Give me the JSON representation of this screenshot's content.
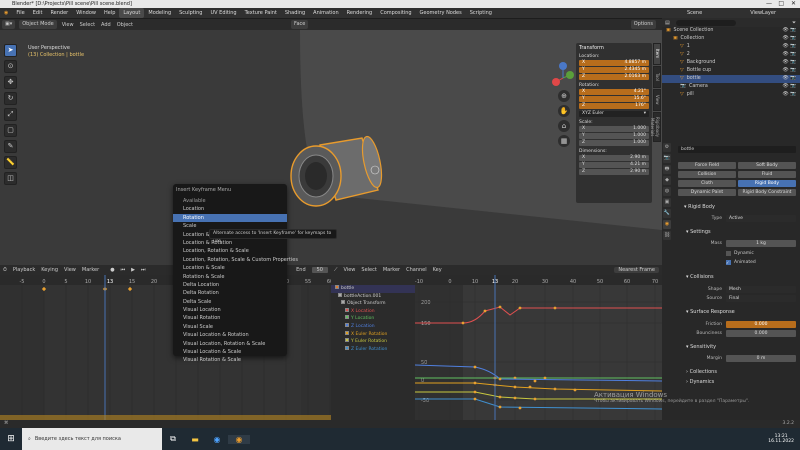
{
  "window": {
    "title": "Blender* [D:\\Projects\\Pill scene\\Pill scene.blend]",
    "controls": [
      "—",
      "□",
      "✕"
    ]
  },
  "menu": {
    "items": [
      "File",
      "Edit",
      "Render",
      "Window",
      "Help"
    ],
    "workspaces": [
      "Layout",
      "Modeling",
      "Sculpting",
      "UV Editing",
      "Texture Paint",
      "Shading",
      "Animation",
      "Rendering",
      "Compositing",
      "Geometry Nodes",
      "Scripting"
    ],
    "active_workspace": "Layout",
    "scene": "Scene",
    "view_layer": "ViewLayer"
  },
  "viewport": {
    "header": {
      "mode": "Object Mode",
      "items": [
        "View",
        "Select",
        "Add",
        "Object"
      ],
      "transform_orientation": "Face",
      "options": "Options"
    },
    "info_line1": "User Perspective",
    "info_line2": "(13) Collection | bottle",
    "nav_icons": [
      "axis-gizmo",
      "zoom-icon",
      "hand-pan-icon",
      "camera-icon",
      "grid-icon"
    ],
    "npanel": {
      "section": "Transform",
      "location_label": "Location:",
      "location": [
        {
          "axis": "X",
          "value": "4.8857 m"
        },
        {
          "axis": "Y",
          "value": "2.4345 m"
        },
        {
          "axis": "Z",
          "value": "2.0163 m"
        }
      ],
      "rotation_label": "Rotation:",
      "rotation": [
        {
          "axis": "X",
          "value": "4.21°"
        },
        {
          "axis": "Y",
          "value": "15.6°"
        },
        {
          "axis": "Z",
          "value": "176°"
        }
      ],
      "rotation_mode": "XYZ Euler",
      "scale_label": "Scale:",
      "scale": [
        {
          "axis": "X",
          "value": "1.000"
        },
        {
          "axis": "Y",
          "value": "1.000"
        },
        {
          "axis": "Z",
          "value": "1.000"
        }
      ],
      "dimensions_label": "Dimensions:",
      "dimensions": [
        {
          "axis": "X",
          "value": "2.90 m"
        },
        {
          "axis": "Y",
          "value": "4.21 m"
        },
        {
          "axis": "Z",
          "value": "2.90 m"
        }
      ]
    },
    "side_tabs": [
      "Item",
      "Tool",
      "View",
      "Rigidbody Materials"
    ]
  },
  "insert_keyframe_menu": {
    "title": "Insert Keyframe Menu",
    "items": [
      "Available",
      "Location",
      "Rotation",
      "Scale",
      "Location & ...",
      "Location & Rotation",
      "Location, Rotation & Scale",
      "Location, Rotation, Scale & Custom Properties",
      "Location & Scale",
      "Rotation & Scale",
      "Delta Location",
      "Delta Rotation",
      "Delta Scale",
      "Visual Location",
      "Visual Rotation",
      "Visual Scale",
      "Visual Location & Rotation",
      "Visual Location, Rotation & Scale",
      "Visual Location & Scale",
      "Visual Rotation & Scale"
    ],
    "highlighted": "Rotation",
    "tooltip": "Alternate access to 'Insert Keyframe' for keymaps to use."
  },
  "outliner": {
    "search_placeholder": "",
    "rows": [
      {
        "indent": 0,
        "name": "Scene Collection",
        "icon": "▣",
        "sel": false
      },
      {
        "indent": 1,
        "name": "Collection",
        "icon": "▣",
        "sel": false
      },
      {
        "indent": 2,
        "name": "1",
        "icon": "▽",
        "sel": false
      },
      {
        "indent": 2,
        "name": "2",
        "icon": "▽",
        "sel": false
      },
      {
        "indent": 2,
        "name": "Background",
        "icon": "▽",
        "sel": false
      },
      {
        "indent": 2,
        "name": "Bottle cup",
        "icon": "▽",
        "sel": false
      },
      {
        "indent": 2,
        "name": "bottle",
        "icon": "▽",
        "sel": true
      },
      {
        "indent": 2,
        "name": "Camera",
        "icon": "📷",
        "sel": false
      },
      {
        "indent": 2,
        "name": "pill",
        "icon": "▽",
        "sel": false
      }
    ]
  },
  "properties": {
    "object_name": "bottle",
    "buttons_row1": [
      "Force Field",
      "Soft Body"
    ],
    "buttons_row2": [
      "Collision",
      "Fluid"
    ],
    "buttons_row3": [
      "Cloth",
      "Rigid Body"
    ],
    "buttons_row4": [
      "Dynamic Paint",
      "Rigid Body Constraint"
    ],
    "rigid_body": "Rigid Body",
    "type_label": "Type",
    "type_value": "Active",
    "settings": "Settings",
    "mass_label": "Mass",
    "mass_value": "1 kg",
    "dynamic": "Dynamic",
    "animated": "Animated",
    "collisions": "Collisions",
    "shape_label": "Shape",
    "shape_value": "Mesh",
    "source_label": "Source",
    "source_value": "Final",
    "surface_response": "Surface Response",
    "friction_label": "Friction",
    "friction_value": "0.000",
    "bounciness_label": "Bounciness",
    "bounciness_value": "0.000",
    "sensitivity": "Sensitivity",
    "margin_label": "Margin",
    "margin_value": "0 m",
    "collections": "Collections",
    "dynamics": "Dynamics"
  },
  "timeline": {
    "menus": [
      "Playback",
      "Keying",
      "View",
      "Marker"
    ],
    "end_label": "End",
    "end_value": "50",
    "ruler": [
      "-5",
      "0",
      "5",
      "10",
      "13",
      "15",
      "20",
      "25",
      "30",
      "35",
      "40",
      "45",
      "50",
      "55",
      "60"
    ],
    "current_frame": "13"
  },
  "graph_editor": {
    "menus": [
      "View",
      "Select",
      "Marker",
      "Channel",
      "Key"
    ],
    "snap": "Nearest Frame",
    "ruler": [
      "-10",
      "0",
      "10",
      "13",
      "20",
      "30",
      "40",
      "50",
      "60",
      "70"
    ],
    "y_labels": [
      "200",
      "150",
      "50",
      "0",
      "-50"
    ],
    "channels": [
      {
        "name": "bottle",
        "color": "#dd7a2d"
      },
      {
        "name": "bottleAction.001",
        "color": "#aaa"
      },
      {
        "name": "Object Transform",
        "color": "#aaa"
      },
      {
        "name": "X Location",
        "color": "#e05050"
      },
      {
        "name": "Y Location",
        "color": "#60c060"
      },
      {
        "name": "Z Location",
        "color": "#5080e0"
      },
      {
        "name": "X Euler Rotation",
        "color": "#e0a020"
      },
      {
        "name": "Y Euler Rotation",
        "color": "#c8c840"
      },
      {
        "name": "Z Euler Rotation",
        "color": "#4090d0"
      }
    ]
  },
  "status": {
    "left": "",
    "version": "3.2.2"
  },
  "activation": {
    "title": "Активация Windows",
    "subtitle": "Чтобы активировать Windows, перейдите в раздел \"Параметры\"."
  },
  "taskbar": {
    "search_placeholder": "Введите здесь текст для поиска",
    "time": "13:21",
    "date": "16.11.2022",
    "lang": "РУС"
  }
}
